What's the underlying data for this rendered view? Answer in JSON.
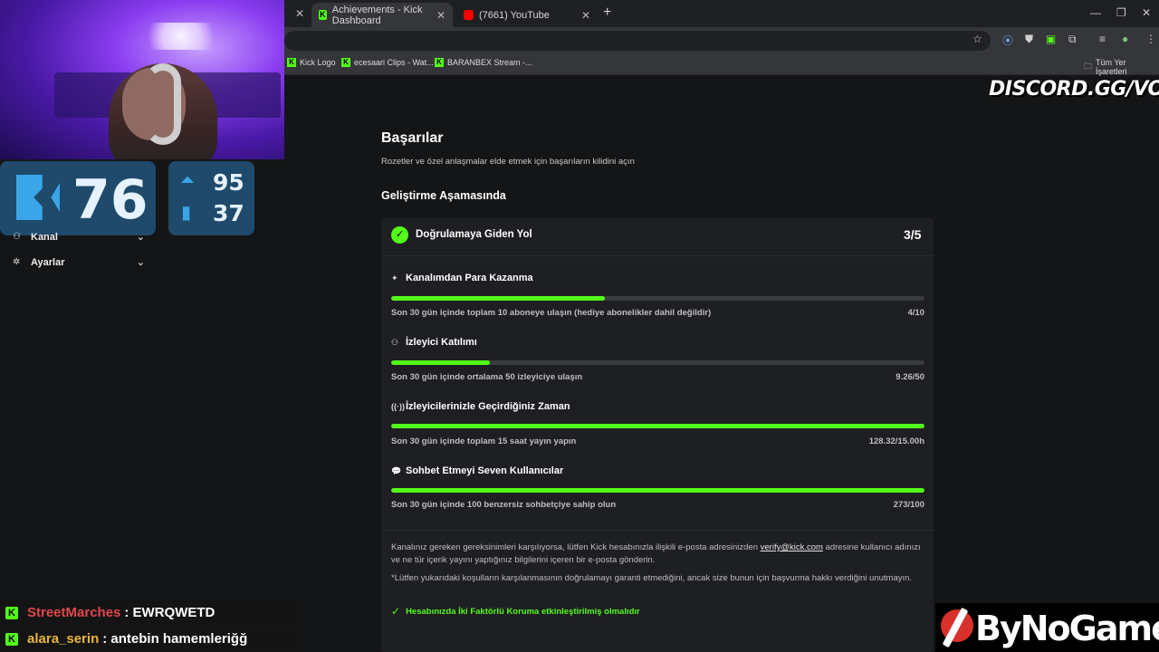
{
  "browser": {
    "tabs": [
      {
        "label": "Achievements - Kick Dashboard"
      },
      {
        "label": "(7661) YouTube"
      }
    ],
    "new_tab": "+",
    "bookmarks": [
      {
        "label": "Kick Logo"
      },
      {
        "label": "ecesaari Clips - Wat..."
      },
      {
        "label": "BARANBEX Stream -..."
      }
    ],
    "all_bookmarks": "Tüm Yer İşaretleri"
  },
  "overlay": {
    "kick_count": "76",
    "stat_a": "95",
    "stat_b": "37",
    "watermark": "DISCORD.GG/VOXZ",
    "brand": "ByNoGame"
  },
  "sidebar": {
    "items": [
      {
        "label": "Kanal",
        "icon": "users-icon"
      },
      {
        "label": "Ayarlar",
        "icon": "gear-icon"
      }
    ]
  },
  "chat": [
    {
      "user": "StreetMarches",
      "message": ": EWRQWETD",
      "color": "#e0474c"
    },
    {
      "user": "alara_serin",
      "message": ": antebin hamemleriğğ",
      "color": "#e8b63a"
    }
  ],
  "page": {
    "title": "Başarılar",
    "subtitle": "Rozetler ve özel anlaşmalar elde etmek için başarıların kilidini açın",
    "section": "Geliştirme Aşamasında",
    "card": {
      "title": "Doğrulamaya Giden Yol",
      "count": "3/5",
      "tasks": [
        {
          "title": "Kanalımdan Para Kazanma",
          "desc": "Son 30 gün içinde toplam 10 aboneye ulaşın (hediye abonelikler dahil değildir)",
          "value": "4/10",
          "progress": 0.4
        },
        {
          "title": "İzleyici Katılımı",
          "desc": "Son 30 gün içinde ortalama 50 izleyiciye ulaşın",
          "value": "9.26/50",
          "progress": 0.185
        },
        {
          "title": "İzleyicilerinizle Geçirdiğiniz Zaman",
          "desc": "Son 30 gün içinde toplam 15 saat yayın yapın",
          "value": "128.32/15.00h",
          "progress": 1.0
        },
        {
          "title": "Sohbet Etmeyi Seven Kullanıcılar",
          "desc": "Son 30 gün içinde 100 benzersiz sohbetçiye sahip olun",
          "value": "273/100",
          "progress": 1.0
        }
      ],
      "note_1a": "Kanalınız gereken gereksinimleri karşılıyorsa, lütfen Kick hesabınızla ilişkili e-posta adresinizden ",
      "note_link": "verify@kick.com",
      "note_1b": " adresine kullanıcı adınızı ve ne tür içerik yayını yaptığınız bilgilerini içeren bir e-posta gönderin.",
      "note_2": "*Lütfen yukarıdaki koşulların karşılanmasının doğrulamayı garanti etmediğini, ancak size bunun için başvurma hakkı verdiğini unutmayın.",
      "requirement": "Hesabınızda İki Faktörlü Koruma etkinleştirilmiş olmalıdır"
    }
  }
}
